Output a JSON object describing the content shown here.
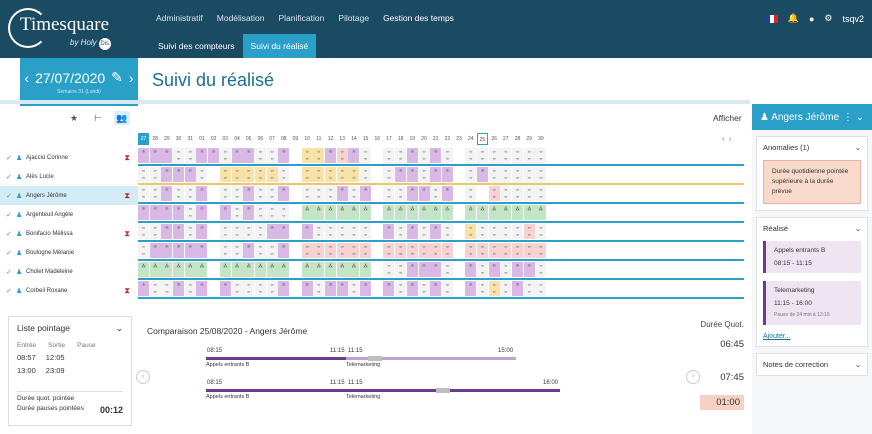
{
  "app": {
    "logo_name": "Timesquare",
    "logo_by": "by Holy",
    "logo_badge": "Dis"
  },
  "nav": {
    "items": [
      "Administratif",
      "Modélisation",
      "Planification",
      "Pilotage",
      "Gestion des temps"
    ],
    "active": 4
  },
  "subtabs": {
    "items": [
      "Suivi des compteurs",
      "Suivi du réalisé"
    ],
    "active": 1
  },
  "topicons": {
    "user": "tsqv2"
  },
  "date": {
    "value": "27/07/2020",
    "week": "Semaine 31 (Lundi)"
  },
  "page": {
    "title": "Suivi du réalisé",
    "afficher": "Afficher"
  },
  "days": [
    "27",
    "28",
    "29",
    "30",
    "31",
    "01",
    "02",
    "03",
    "04",
    "05",
    "06",
    "07",
    "08",
    "09",
    "10",
    "11",
    "12",
    "13",
    "14",
    "15",
    "16",
    "17",
    "18",
    "19",
    "20",
    "21",
    "22",
    "23",
    "24",
    "25",
    "26",
    "27",
    "28",
    "29",
    "30"
  ],
  "people": [
    {
      "name": "Ajaccio Corinne",
      "alert": true
    },
    {
      "name": "Alès Lucie",
      "alert": false
    },
    {
      "name": "Angers Jérôme",
      "alert": true,
      "selected": true
    },
    {
      "name": "Argenteuil Angèle",
      "alert": false
    },
    {
      "name": "Bonifacio Mélissa",
      "alert": true
    },
    {
      "name": "Boulogne Mélanie",
      "alert": false
    },
    {
      "name": "Cholet Madeleine",
      "alert": false
    },
    {
      "name": "Corbeil Roxane",
      "alert": true
    }
  ],
  "listpointage": {
    "title": "Liste pointage",
    "headers": [
      "Entrée",
      "Sortie",
      "Pause"
    ],
    "rows": [
      [
        "08:57",
        "12:05"
      ],
      [
        "13:00",
        "23:09"
      ]
    ],
    "footer1_label": "Durée quot. pointée",
    "footer2_label": "Durée pauses pointées",
    "footer2_value": "00:12"
  },
  "comparison": {
    "title": "Comparaison 25/08/2020 - Angers Jérôme",
    "line1": {
      "start": "08:15",
      "mid": "11:15",
      "mid2": "11:15",
      "end": "15:00",
      "label1": "Appels entrants B",
      "label2": "Telemarketing"
    },
    "line2": {
      "start": "08:15",
      "mid": "11:15",
      "mid2": "11:15",
      "end": "16:00",
      "label1": "Appels entrants B",
      "label2": "Telemarketing"
    }
  },
  "duree": {
    "label": "Durée Quot.",
    "v1": "06:45",
    "v2": "07:45",
    "diff": "01:00"
  },
  "right": {
    "person": "Angers Jérôme",
    "anomalies_title": "Anomalies (1)",
    "anomaly_text": "Durée quotidienne pointée supérieure à la durée prévue",
    "realise_title": "Réalisé",
    "r1_name": "Appels entrants B",
    "r1_time": "08:15 - 11:15",
    "r2_name": "Telemarketing",
    "r2_time": "11:15 - 16:00",
    "r2_note": "Pause de 24 min à 13:15",
    "ajouter": "Ajouter...",
    "notes_title": "Notes de correction"
  },
  "colors": {
    "navy": "#1b4a63",
    "accent": "#2aa0c8",
    "purple": "#6a3c8e",
    "alert": "#c2272d"
  }
}
